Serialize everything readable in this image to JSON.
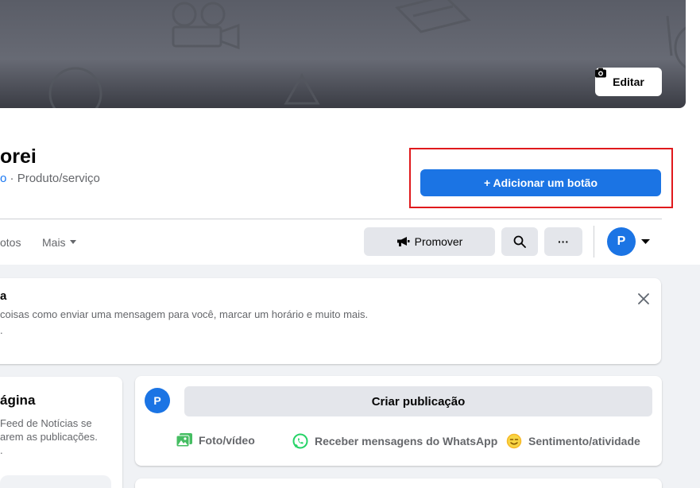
{
  "cover": {
    "edit_label": "Editar",
    "edit_icon": "camera-icon"
  },
  "page": {
    "name": "orei",
    "category_link": "o",
    "category_separator": " · ",
    "category": "Produto/serviço"
  },
  "actions": {
    "add_button_label": "+ Adicionar um botão",
    "promote_label": "Promover",
    "promote_icon": "megaphone-icon",
    "search_icon": "search-icon",
    "more_label": "···",
    "avatar_letter": "P"
  },
  "tabs": {
    "photos": "otos",
    "more": "Mais"
  },
  "notice": {
    "title": "a",
    "text": "coisas como enviar uma mensagem para você, marcar um horário e muito mais.",
    "extra": "."
  },
  "side": {
    "title": "ágina",
    "lines": [
      "Feed de Notícias se",
      "arem as publicações.",
      "."
    ]
  },
  "post": {
    "avatar_letter": "P",
    "create_label": "Criar publicação",
    "photo_label": "Foto/vídeo",
    "whatsapp_label": "Receber mensagens do WhatsApp",
    "feeling_label": "Sentimento/atividade"
  },
  "colors": {
    "primary": "#1b74e4",
    "highlight": "#e0191c",
    "photo_green": "#45bd62",
    "whatsapp_green": "#25d366",
    "feeling_yellow": "#f7b928"
  }
}
